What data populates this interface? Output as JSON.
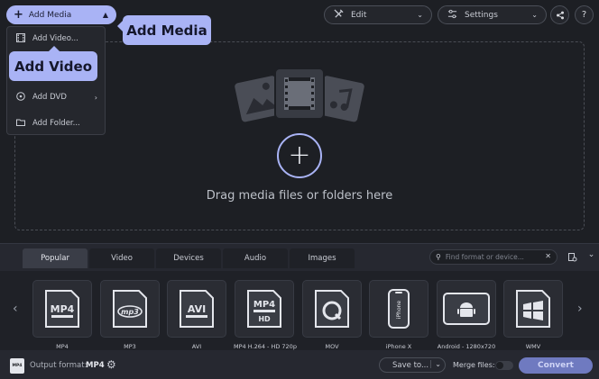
{
  "toolbar": {
    "add_media_label": "Add Media",
    "edit_label": "Edit",
    "settings_label": "Settings"
  },
  "add_media_menu": {
    "items": [
      {
        "label": "Add Video..."
      },
      {
        "label": "Add DVD"
      },
      {
        "label": "Add Folder..."
      }
    ]
  },
  "callouts": {
    "add_media": "Add Media",
    "add_video": "Add Video"
  },
  "dropzone": {
    "text": "Drag media files or folders here"
  },
  "format_panel": {
    "tabs": [
      {
        "label": "Popular",
        "active": true
      },
      {
        "label": "Video",
        "active": false
      },
      {
        "label": "Devices",
        "active": false
      },
      {
        "label": "Audio",
        "active": false
      },
      {
        "label": "Images",
        "active": false
      }
    ],
    "search_placeholder": "Find format or device...",
    "formats": [
      {
        "label": "MP4",
        "icon": "mp4-file-icon"
      },
      {
        "label": "MP3",
        "icon": "mp3-file-icon"
      },
      {
        "label": "AVI",
        "icon": "avi-file-icon"
      },
      {
        "label": "MP4 H.264 - HD 720p",
        "icon": "mp4-hd-file-icon"
      },
      {
        "label": "MOV",
        "icon": "quicktime-icon"
      },
      {
        "label": "iPhone X",
        "icon": "iphone-icon"
      },
      {
        "label": "Android - 1280x720",
        "icon": "android-tablet-icon"
      },
      {
        "label": "WMV",
        "icon": "windows-icon"
      }
    ]
  },
  "bottom_bar": {
    "output_format_label": "Output format:",
    "output_format_value": "MP4",
    "save_to_label": "Save to...",
    "merge_files_label": "Merge files:",
    "convert_label": "Convert"
  },
  "colors": {
    "accent": "#a9b3f5",
    "background": "#1d1f24",
    "panel": "#262830"
  }
}
